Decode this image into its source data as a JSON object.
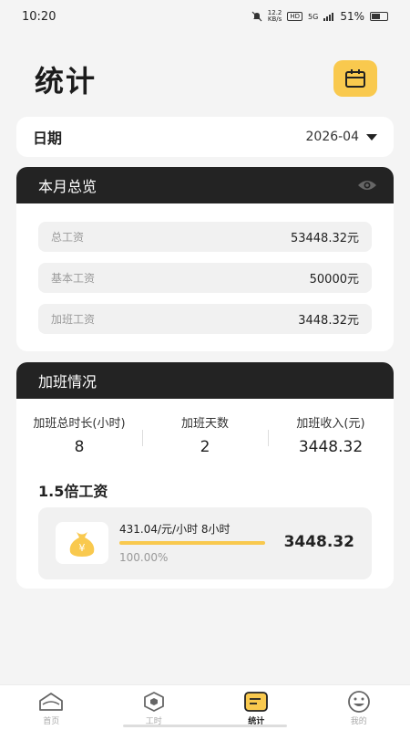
{
  "status_bar": {
    "time": "10:20",
    "speed_top": "12.2",
    "speed_bottom": "KB/s",
    "hd": "HD",
    "network": "5G",
    "battery": "51%"
  },
  "header": {
    "title": "统计",
    "calendar_icon": "calendar-icon"
  },
  "date": {
    "label": "日期",
    "value": "2026-04"
  },
  "overview": {
    "title": "本月总览",
    "rows": [
      {
        "label": "总工资",
        "value": "53448.32元"
      },
      {
        "label": "基本工资",
        "value": "50000元"
      },
      {
        "label": "加班工资",
        "value": "3448.32元"
      }
    ]
  },
  "overtime": {
    "title": "加班情况",
    "stats": [
      {
        "label": "加班总时长(小时)",
        "value": "8"
      },
      {
        "label": "加班天数",
        "value": "2"
      },
      {
        "label": "加班收入(元)",
        "value": "3448.32"
      }
    ],
    "rate": {
      "title": "1.5倍工资",
      "detail": "431.04/元/小时 8小时",
      "percent": "100.00%",
      "progress": 1.0,
      "amount": "3448.32"
    }
  },
  "nav": [
    {
      "label": "首页",
      "icon": "home-icon"
    },
    {
      "label": "工时",
      "icon": "hexagon-icon"
    },
    {
      "label": "统计",
      "icon": "stats-icon"
    },
    {
      "label": "我的",
      "icon": "smiley-icon"
    }
  ],
  "colors": {
    "accent": "#f9c94e",
    "dark": "#232323",
    "background": "#f4f4f4"
  }
}
